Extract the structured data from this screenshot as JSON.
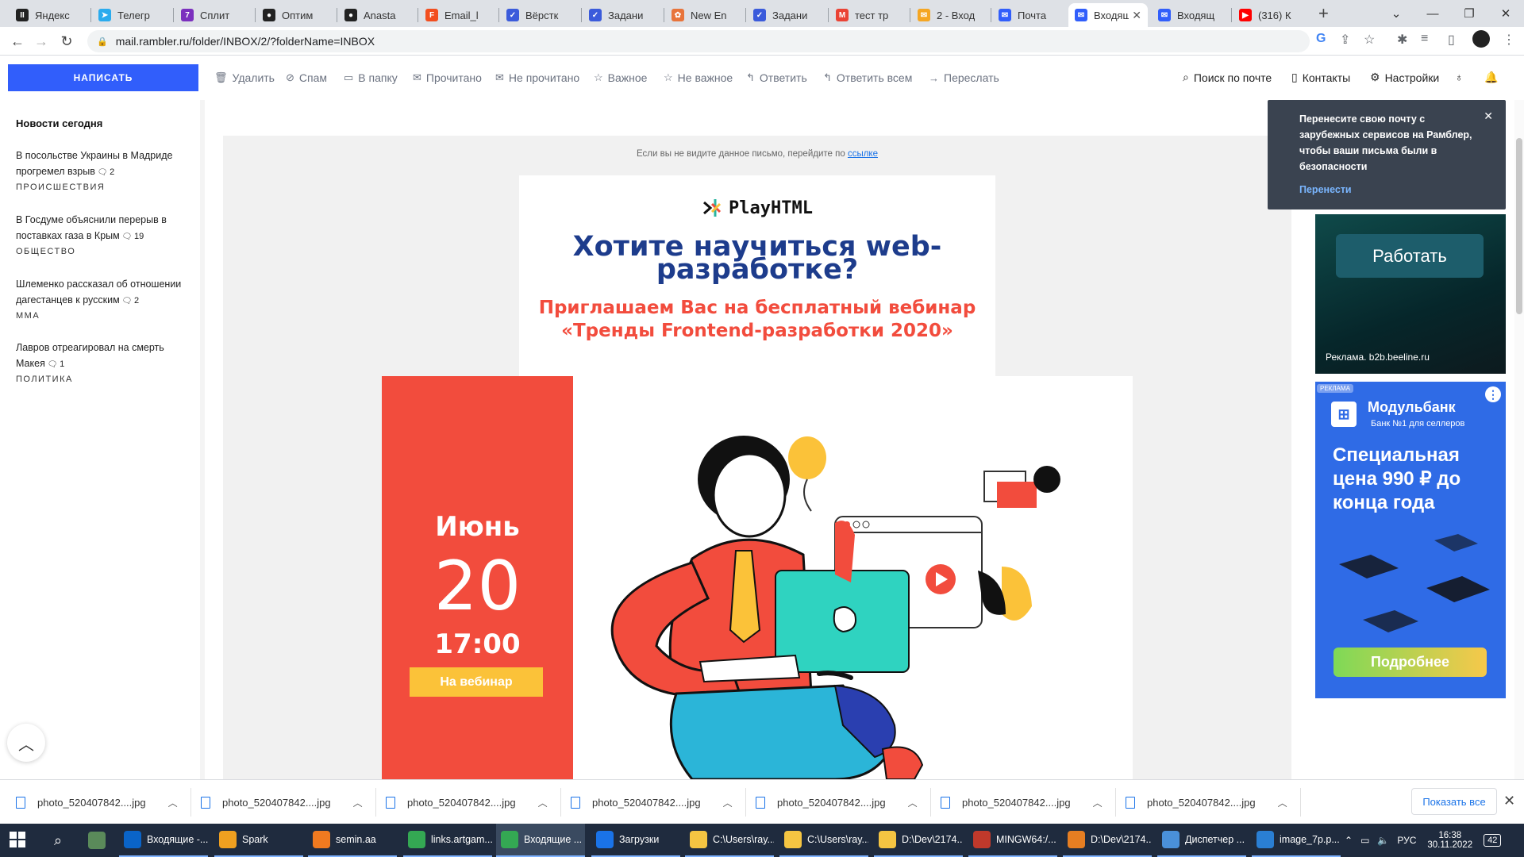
{
  "browser": {
    "tabs": [
      {
        "title": "Яндекс",
        "color": "#222222",
        "glyph": "II"
      },
      {
        "title": "Телегр",
        "color": "#2aabee",
        "glyph": "➤"
      },
      {
        "title": "Сплит",
        "color": "#7b2fbe",
        "glyph": "7"
      },
      {
        "title": "Оптим",
        "color": "#222222",
        "glyph": "●"
      },
      {
        "title": "Anasta",
        "color": "#222222",
        "glyph": "●"
      },
      {
        "title": "Email_l",
        "color": "#f24e1e",
        "glyph": "F"
      },
      {
        "title": "Вёрстк",
        "color": "#3b5bdb",
        "glyph": "✓"
      },
      {
        "title": "Задани",
        "color": "#3b5bdb",
        "glyph": "✓"
      },
      {
        "title": "New En",
        "color": "#e8743b",
        "glyph": "✿"
      },
      {
        "title": "Задани",
        "color": "#3b5bdb",
        "glyph": "✓"
      },
      {
        "title": "тест тр",
        "color": "#ea4335",
        "glyph": "M"
      },
      {
        "title": "2 - Вход",
        "color": "#f5a623",
        "glyph": "✉"
      },
      {
        "title": "Почта",
        "color": "#315efb",
        "glyph": "✉"
      },
      {
        "title": "Входящ",
        "color": "#315efb",
        "glyph": "✉",
        "active": true
      },
      {
        "title": "Входящ",
        "color": "#315efb",
        "glyph": "✉"
      },
      {
        "title": "(316) К",
        "color": "#ff0000",
        "glyph": "▶"
      }
    ],
    "url": "mail.rambler.ru/folder/INBOX/2/?folderName=INBOX"
  },
  "toolbar": {
    "compose": "НАПИСАТЬ",
    "actions": [
      {
        "label": "Удалить",
        "icon": "trash-icon",
        "glyph": "🗑"
      },
      {
        "label": "Спам",
        "icon": "spam-icon",
        "glyph": "⊘"
      },
      {
        "label": "В папку",
        "icon": "folder-icon",
        "glyph": "▭"
      },
      {
        "label": "Прочитано",
        "icon": "read-icon",
        "glyph": "✉"
      },
      {
        "label": "Не прочитано",
        "icon": "unread-icon",
        "glyph": "✉"
      },
      {
        "label": "Важное",
        "icon": "star-icon",
        "glyph": "☆"
      },
      {
        "label": "Не важное",
        "icon": "unstar-icon",
        "glyph": "☆"
      },
      {
        "label": "Ответить",
        "icon": "reply-icon",
        "glyph": "↰"
      },
      {
        "label": "Ответить всем",
        "icon": "reply-all-icon",
        "glyph": "↰"
      },
      {
        "label": "Переслать",
        "icon": "forward-icon",
        "glyph": "→"
      }
    ],
    "search": "Поиск по почте",
    "contacts": "Контакты",
    "settings": "Настройки"
  },
  "sidebar": {
    "title": "Новости сегодня",
    "news": [
      {
        "text": "В посольстве Украины в Мадриде прогремел взрыв",
        "comments": "2",
        "category": "ПРОИСШЕСТВИЯ"
      },
      {
        "text": "В Госдуме объяснили перерыв в поставках газа в Крым",
        "comments": "19",
        "category": "ОБЩЕСТВО"
      },
      {
        "text": "Шлеменко рассказал об отношении дагестанцев к русским",
        "comments": "2",
        "category": "MMA"
      },
      {
        "text": "Лавров отреагировал на смерть Макея",
        "comments": "1",
        "category": "ПОЛИТИКА"
      }
    ]
  },
  "email": {
    "notice_text": "Если вы не видите данное письмо, перейдите по ",
    "notice_link": "ссылке",
    "brand": "PlayHTML",
    "headline": "Хотите научиться web-разработке?",
    "subheadline": "Приглашаем Вас на бесплатный вебинар «Тренды Frontend-разработки 2020»",
    "month": "Июнь",
    "day": "20",
    "time": "17:00",
    "cta": "На вебинар"
  },
  "popup": {
    "message": "Перенесите свою почту с зарубежных сервисов на Рамблер, чтобы ваши письма были в безопасности",
    "action": "Перенести"
  },
  "ads": {
    "ad1_button": "Работать",
    "ad1_caption": "Реклама. b2b.beeline.ru",
    "ad2_badge": "РЕКЛАМА",
    "ad2_brand": "Модульбанк",
    "ad2_tagline": "Банк №1 для селлеров",
    "ad2_offer": "Специальная цена 990 ₽ до конца года",
    "ad2_button": "Подробнее"
  },
  "downloads": {
    "files": [
      "photo_520407842....jpg",
      "photo_520407842....jpg",
      "photo_520407842....jpg",
      "photo_520407842....jpg",
      "photo_520407842....jpg",
      "photo_520407842....jpg",
      "photo_520407842....jpg"
    ],
    "show_all": "Показать все"
  },
  "taskbar": {
    "apps": [
      {
        "label": "Входящие -...",
        "color": "#0a64c8"
      },
      {
        "label": "Spark",
        "color": "#f0a020"
      },
      {
        "label": "semin.aa",
        "color": "#f07a20"
      },
      {
        "label": "links.artgam...",
        "color": "#34a853"
      },
      {
        "label": "Входящие ...",
        "color": "#34a853",
        "active": true
      },
      {
        "label": "Загрузки",
        "color": "#1a73e8"
      },
      {
        "label": "C:\\Users\\ray...",
        "color": "#f5c542"
      },
      {
        "label": "C:\\Users\\ray...",
        "color": "#f5c542"
      },
      {
        "label": "D:\\Dev\\2174...",
        "color": "#f5c542"
      },
      {
        "label": "MINGW64:/...",
        "color": "#c0392b"
      },
      {
        "label": "D:\\Dev\\2174...",
        "color": "#e67e22"
      },
      {
        "label": "Диспетчер ...",
        "color": "#4a90d9"
      },
      {
        "label": "image_7p.p...",
        "color": "#2a7fd4"
      }
    ],
    "lang": "РУС",
    "time": "16:38",
    "date": "30.11.2022",
    "notif_count": "42"
  }
}
